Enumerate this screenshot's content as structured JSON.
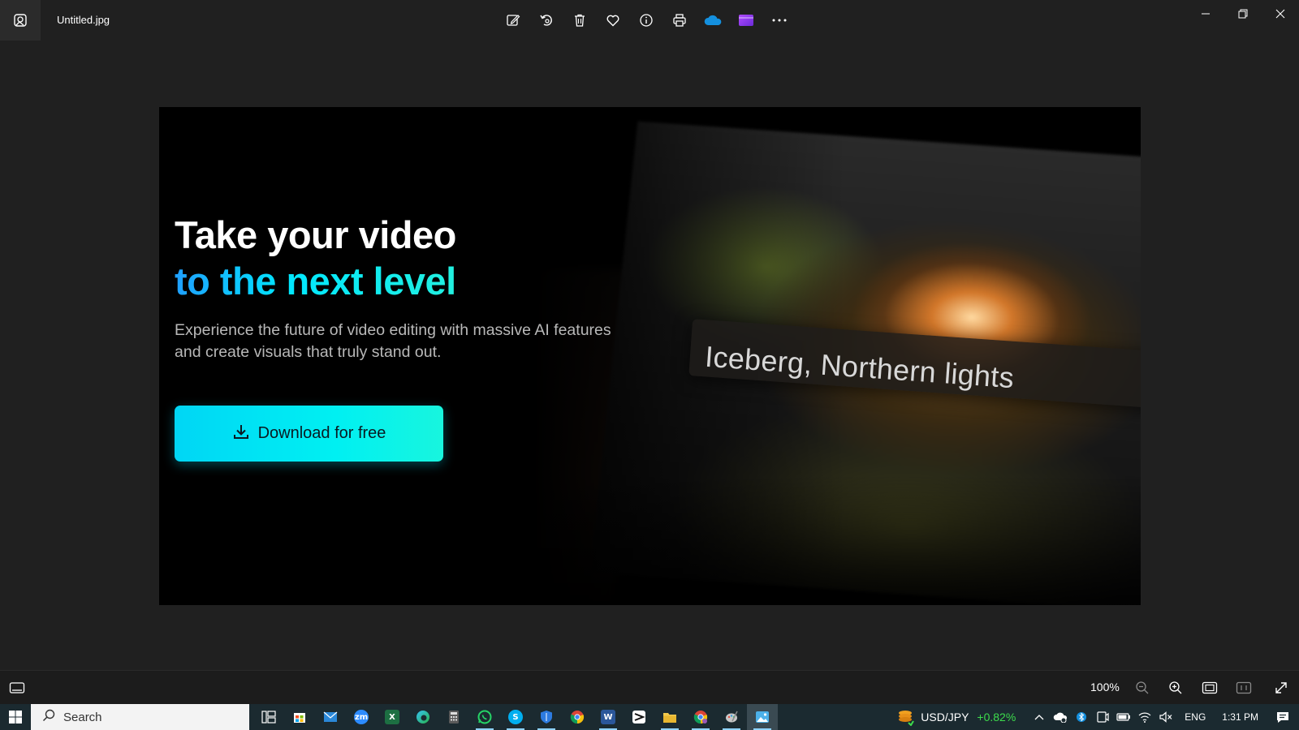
{
  "window": {
    "title": "Untitled.jpg",
    "toolbar": [
      {
        "name": "edit-image-icon"
      },
      {
        "name": "rotate-icon"
      },
      {
        "name": "delete-icon"
      },
      {
        "name": "favorite-heart-icon"
      },
      {
        "name": "info-icon"
      },
      {
        "name": "print-icon"
      },
      {
        "name": "onedrive-cloud-icon"
      },
      {
        "name": "clipchamp-icon"
      },
      {
        "name": "more-icon"
      }
    ]
  },
  "photo": {
    "headline_line1": "Take your video",
    "headline_line2": "to the next level",
    "subtext": "Experience the future of video editing with massive AI features and create visuals that truly stand out.",
    "cta_label": "Download for free",
    "caption": "Iceberg, Northern lights"
  },
  "viewer": {
    "zoom": "100%"
  },
  "taskbar": {
    "search_label": "Search",
    "apps": [
      {
        "name": "task-view",
        "label": "",
        "color": "#1b2a30"
      },
      {
        "name": "microsoft-store",
        "label": "",
        "color": "#ffffff"
      },
      {
        "name": "mail",
        "label": "",
        "color": "#2b88d8"
      },
      {
        "name": "zoom",
        "label": "zm",
        "color": "#2d8cff"
      },
      {
        "name": "excel",
        "label": "X",
        "color": "#1d6f42"
      },
      {
        "name": "edge",
        "label": "",
        "color": "#0fa5a5"
      },
      {
        "name": "calculator",
        "label": "",
        "color": "#5a5a5a"
      },
      {
        "name": "whatsapp",
        "label": "",
        "color": "#25d366"
      },
      {
        "name": "skype",
        "label": "S",
        "color": "#00aff0"
      },
      {
        "name": "defender",
        "label": "",
        "color": "#2d7be0"
      },
      {
        "name": "chrome",
        "label": "",
        "color": "#e9b229"
      },
      {
        "name": "word",
        "label": "W",
        "color": "#2b579a"
      },
      {
        "name": "capcut",
        "label": "",
        "color": "#ffffff"
      },
      {
        "name": "file-explorer",
        "label": "",
        "color": "#f2c94c"
      },
      {
        "name": "chrome-profile",
        "label": "",
        "color": "#db4437"
      },
      {
        "name": "paint-tool",
        "label": "",
        "color": "#a0a0a0"
      },
      {
        "name": "photos",
        "label": "",
        "color": "#4cb0e8"
      }
    ],
    "ticker_symbol": "USD/JPY",
    "ticker_change": "+0.82%",
    "language": "ENG",
    "time": "1:31 PM",
    "accent": "#00e7ff"
  }
}
